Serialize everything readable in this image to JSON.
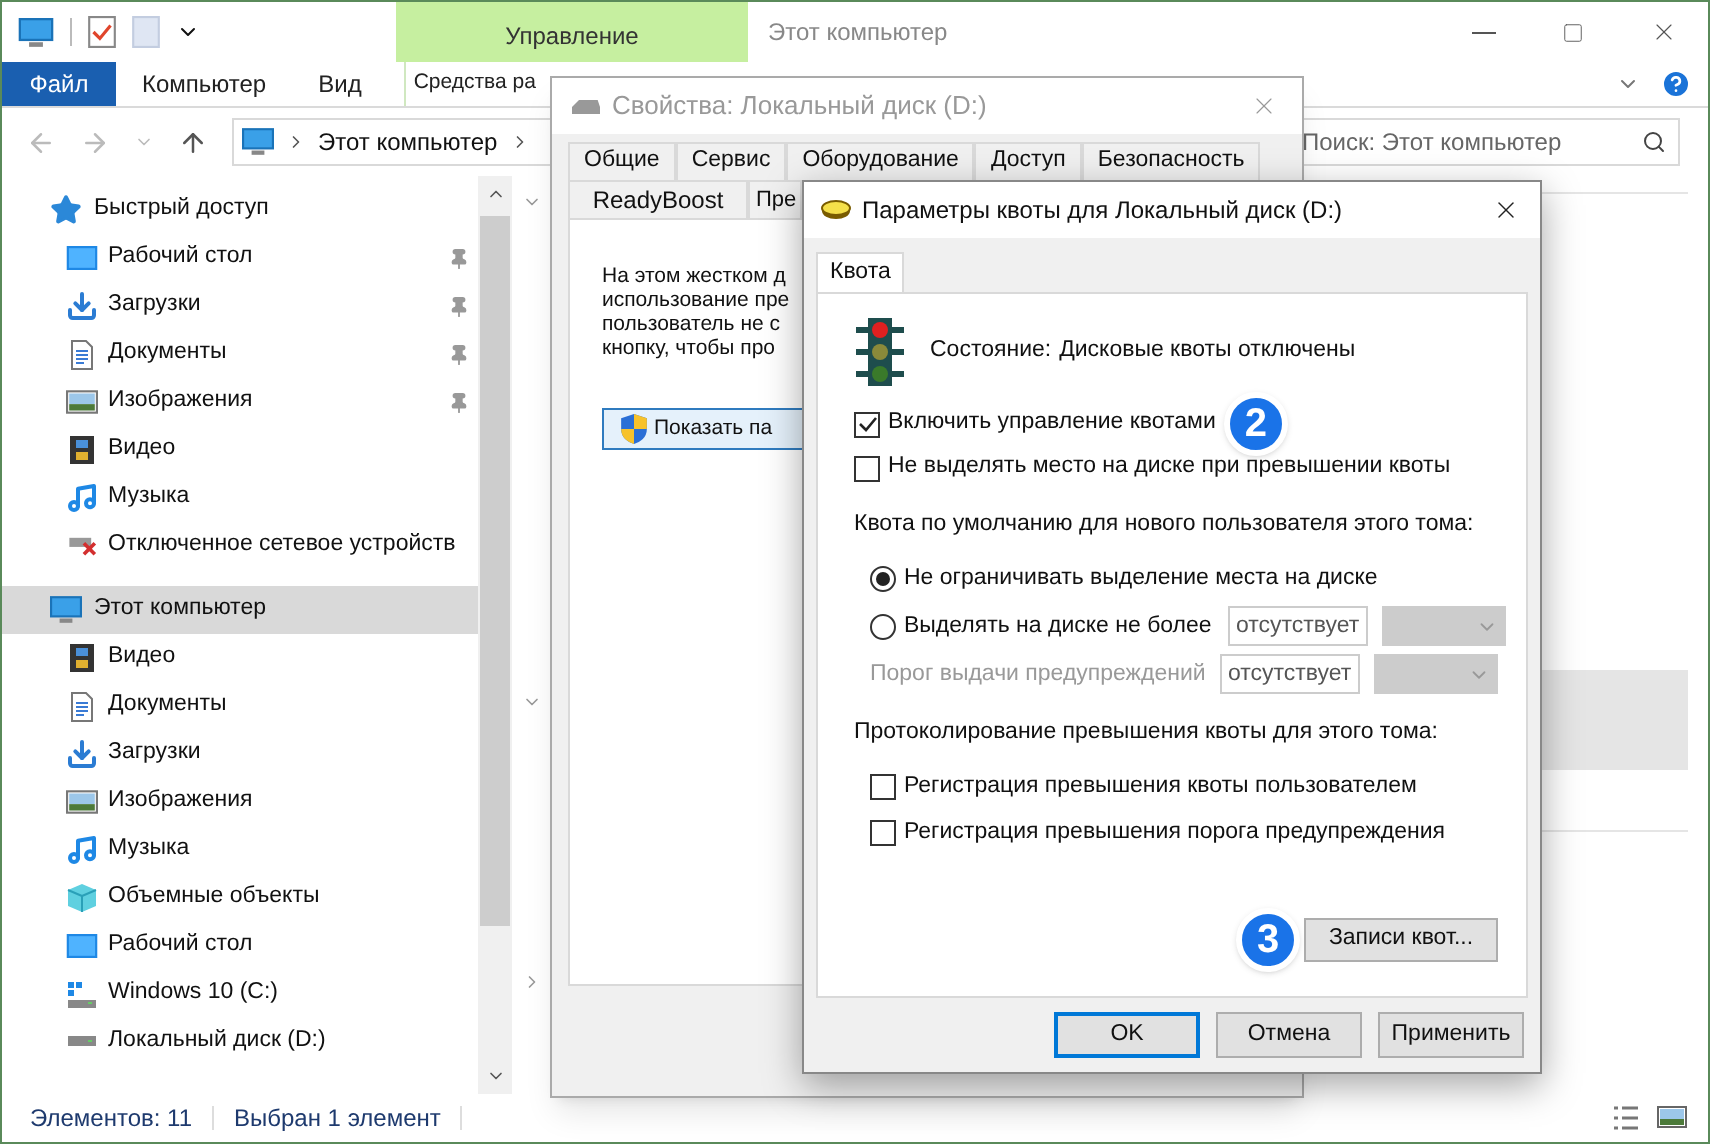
{
  "explorer": {
    "title": "Этот компьютер",
    "context_group": "Управление",
    "ribbon_tabs": [
      {
        "label": "Файл",
        "kind": "file"
      },
      {
        "label": "Компьютер",
        "kind": "normal"
      },
      {
        "label": "Вид",
        "kind": "normal"
      },
      {
        "label": "Средства ра",
        "kind": "context"
      }
    ],
    "address": "Этот компьютер",
    "search": {
      "placeholder": "Поиск: Этот компьютер"
    },
    "nav": [
      {
        "label": "Быстрый доступ",
        "kind": "star",
        "selected": false,
        "children": [
          {
            "label": "Рабочий стол",
            "kind": "desktop",
            "pinned": true,
            "selected": false
          },
          {
            "label": "Загрузки",
            "kind": "download",
            "pinned": true,
            "selected": false
          },
          {
            "label": "Документы",
            "kind": "docs",
            "pinned": true,
            "selected": false
          },
          {
            "label": "Изображения",
            "kind": "images",
            "pinned": true,
            "selected": false
          },
          {
            "label": "Видео",
            "kind": "video",
            "pinned": false,
            "selected": false
          },
          {
            "label": "Музыка",
            "kind": "music",
            "pinned": false,
            "selected": false
          },
          {
            "label": "Отключенное сетевое устройств",
            "kind": "netdrive",
            "pinned": false,
            "selected": false
          }
        ]
      },
      {
        "label": "Этот компьютер",
        "kind": "pc",
        "selected": true,
        "children": [
          {
            "label": "Видео",
            "kind": "video",
            "pinned": false,
            "selected": false
          },
          {
            "label": "Документы",
            "kind": "docs",
            "pinned": false,
            "selected": false
          },
          {
            "label": "Загрузки",
            "kind": "download",
            "pinned": false,
            "selected": false
          },
          {
            "label": "Изображения",
            "kind": "images",
            "pinned": false,
            "selected": false
          },
          {
            "label": "Музыка",
            "kind": "music",
            "pinned": false,
            "selected": false
          },
          {
            "label": "Объемные объекты",
            "kind": "objects",
            "pinned": false,
            "selected": false
          },
          {
            "label": "Рабочий стол",
            "kind": "desktop",
            "pinned": false,
            "selected": false
          },
          {
            "label": "Windows 10 (C:)",
            "kind": "windrive",
            "pinned": false,
            "selected": false
          },
          {
            "label": "Локальный диск (D:)",
            "kind": "drive",
            "pinned": false,
            "selected": false
          }
        ]
      }
    ],
    "status": [
      "Элементов: 11",
      "Выбран 1 элемент"
    ]
  },
  "properties": {
    "title": "Свойства: Локальный диск (D:)",
    "tab_rows": [
      [
        {
          "label": "Общие",
          "selected": false
        },
        {
          "label": "Сервис",
          "selected": false
        },
        {
          "label": "Оборудование",
          "selected": false
        },
        {
          "label": "Доступ",
          "selected": false
        },
        {
          "label": "Безопасность",
          "selected": false
        }
      ],
      [
        {
          "label": "ReadyBoost",
          "selected": false
        },
        {
          "label": "Пре",
          "selected": false
        }
      ]
    ],
    "lines": [
      "На этом жестком д",
      "использование пре",
      "пользователь не с",
      "кнопку, чтобы про"
    ],
    "button": "Показать па"
  },
  "quota": {
    "title": "Параметры квоты для Локальный диск (D:)",
    "tabs": [
      {
        "label": "Квота",
        "selected": true
      }
    ],
    "status_label": "Состояние:",
    "status_value": "Дисковые квоты отключены",
    "options": [
      {
        "label": "Включить управление квотами",
        "checked": true,
        "badge": "2"
      },
      {
        "label": "Не выделять место на диске при превышении квоты",
        "checked": false
      }
    ],
    "default_heading": "Квота по умолчанию для нового пользователя этого тома:",
    "radios": [
      {
        "label": "Не ограничивать выделение места на диске",
        "selected": true
      },
      {
        "label": "Выделять на диске не более",
        "selected": false,
        "value": "отсутствует"
      }
    ],
    "warning": {
      "label": "Порог выдачи предупреждений",
      "value": "отсутствует",
      "disabled": true
    },
    "log_heading": "Протоколирование превышения квоты для этого тома:",
    "log_options": [
      {
        "label": "Регистрация превышения квоты пользователем",
        "checked": false
      },
      {
        "label": "Регистрация превышения порога предупреждения",
        "checked": false
      }
    ],
    "entries_button": {
      "label": "Записи квот...",
      "badge": "3"
    },
    "buttons": [
      {
        "label": "OK",
        "default": true
      },
      {
        "label": "Отмена",
        "default": false
      },
      {
        "label": "Применить",
        "default": false
      }
    ]
  }
}
